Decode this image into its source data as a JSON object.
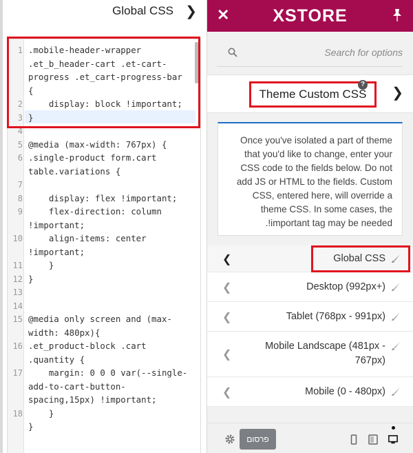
{
  "left_panel": {
    "title": "Global CSS",
    "chevron": "chevron-right-icon",
    "editor_lines": [
      {
        "num": "1",
        "text": ".mobile-header-wrapper"
      },
      {
        "num": "",
        "text": ".et_b_header-cart .et-cart-"
      },
      {
        "num": "",
        "text": "progress .et_cart-progress-bar"
      },
      {
        "num": "",
        "text": "{"
      },
      {
        "num": "2",
        "text": "    display: block !important;"
      },
      {
        "num": "3",
        "text": "}"
      },
      {
        "num": "4",
        "text": ""
      },
      {
        "num": "5",
        "text": "@media (max-width: 767px) {"
      },
      {
        "num": "6",
        "text": ".single-product form.cart"
      },
      {
        "num": "",
        "text": "table.variations {"
      },
      {
        "num": "7",
        "text": ""
      },
      {
        "num": "8",
        "text": "    display: flex !important;"
      },
      {
        "num": "9",
        "text": "    flex-direction: column"
      },
      {
        "num": "",
        "text": "!important;"
      },
      {
        "num": "10",
        "text": "    align-items: center"
      },
      {
        "num": "",
        "text": "!important;"
      },
      {
        "num": "11",
        "text": "    }"
      },
      {
        "num": "12",
        "text": "}"
      },
      {
        "num": "13",
        "text": ""
      },
      {
        "num": "14",
        "text": ""
      },
      {
        "num": "15",
        "text": "@media only screen and (max-"
      },
      {
        "num": "",
        "text": "width: 480px){"
      },
      {
        "num": "16",
        "text": ".et_product-block .cart"
      },
      {
        "num": "",
        "text": ".quantity {"
      },
      {
        "num": "17",
        "text": "    margin: 0 0 0 var(--single-"
      },
      {
        "num": "",
        "text": "add-to-cart-button-"
      },
      {
        "num": "",
        "text": "spacing,15px) !important;"
      },
      {
        "num": "18",
        "text": "    }"
      },
      {
        "num": "",
        "text": "}"
      }
    ]
  },
  "right_panel": {
    "close_icon": "close-icon",
    "logo": "XSTORE",
    "pin_icon": "pin-icon",
    "search_placeholder": "Search for options",
    "section_title": "Theme Custom CSS",
    "help": "?",
    "info_text": "Once you've isolated a part of theme that you'd like to change, enter your CSS code to the fields below. Do not add JS or HTML to the fields. Custom CSS, entered here, will override a theme CSS. In some cases, the !important tag may be needed.",
    "items": [
      {
        "label": "Global CSS"
      },
      {
        "label": "Desktop (992px+)"
      },
      {
        "label": "Tablet (768px - 991px)"
      },
      {
        "label": "Mobile Landscape (481px - 767px)"
      },
      {
        "label": "Mobile (0 - 480px)"
      }
    ],
    "footer": {
      "publish_label": "פרסום",
      "gear_icon": "gear-icon",
      "devices": [
        "mobile-icon",
        "tablet-icon",
        "desktop-icon"
      ]
    }
  },
  "colors": {
    "brand": "#a50b4f",
    "highlight": "#e0141e",
    "accent_blue": "#1a6fc4"
  }
}
